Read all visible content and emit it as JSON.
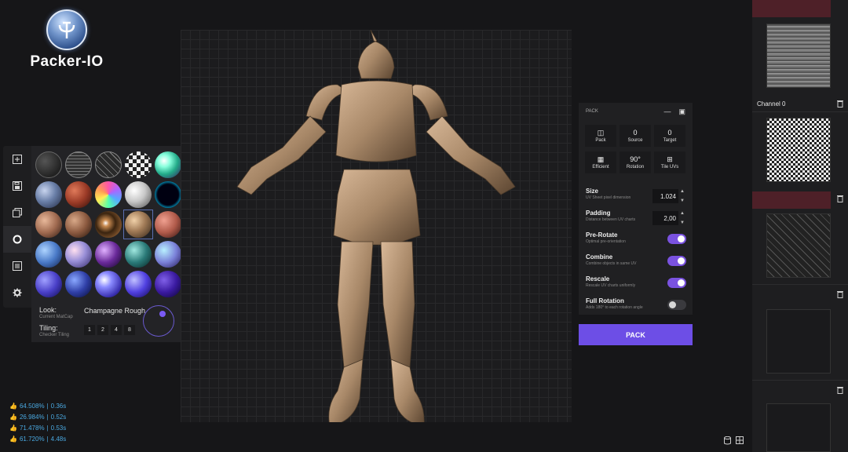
{
  "app": {
    "logo_text": "Packer-IO"
  },
  "toolbar": {
    "icons": [
      "add-icon",
      "save-icon",
      "layers-icon",
      "circle-icon",
      "list-icon",
      "gear-icon"
    ]
  },
  "materials": {
    "look_label": "Look:",
    "look_sub": "Current MatCap",
    "look_value": "Champagne Rough",
    "tiling_label": "Tiling:",
    "tiling_sub": "Checker Tiling",
    "tiling_options": [
      "1",
      "2",
      "4",
      "8"
    ],
    "accent": "#7a5af5"
  },
  "stats": [
    {
      "percent": "64.508%",
      "time": "0.36s"
    },
    {
      "percent": "26.984%",
      "time": "0.52s"
    },
    {
      "percent": "71.478%",
      "time": "0.53s"
    },
    {
      "percent": "61.720%",
      "time": "4.48s"
    }
  ],
  "pack": {
    "header": "PACK",
    "row1": [
      {
        "value": "",
        "label": "Pack"
      },
      {
        "value": "0",
        "label": "Source"
      },
      {
        "value": "0",
        "label": "Target"
      }
    ],
    "row2": [
      {
        "value": "",
        "label": "Efficient"
      },
      {
        "value": "90°",
        "label": "Rotation"
      },
      {
        "value": "",
        "label": "Tile UVs"
      }
    ],
    "size": {
      "name": "Size",
      "desc": "UV Sheet pixel dimension",
      "value": "1.024"
    },
    "padding": {
      "name": "Padding",
      "desc": "Distance between UV charts",
      "value": "2,00"
    },
    "pre_rotate": {
      "name": "Pre-Rotate",
      "desc": "Optimal pre-orientation",
      "on": true
    },
    "combine": {
      "name": "Combine",
      "desc": "Combine objects in same UV",
      "on": true
    },
    "rescale": {
      "name": "Rescale",
      "desc": "Rescale UV charts uniformly",
      "on": true
    },
    "full_rotation": {
      "name": "Full Rotation",
      "desc": "Adds 180° to each rotation angle",
      "on": false
    },
    "button_label": "PACK",
    "button_color": "#6d4ee6"
  },
  "channels": {
    "channel0_label": "Channel 0"
  }
}
